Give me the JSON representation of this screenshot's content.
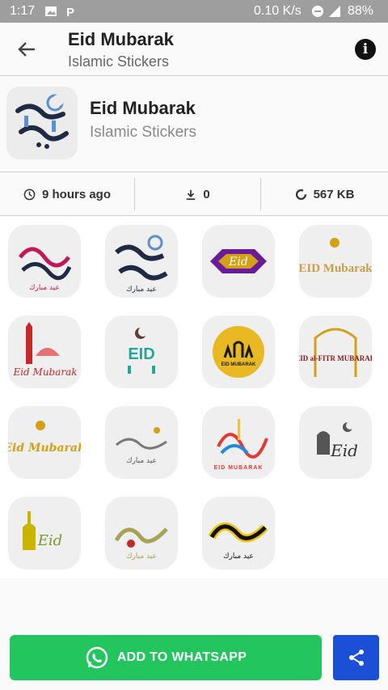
{
  "status_bar": {
    "time": "1:17",
    "net_speed": "0.10 K/s",
    "battery": "88%"
  },
  "app_bar": {
    "title": "Eid Mubarak",
    "subtitle": "Islamic Stickers"
  },
  "pack": {
    "title": "Eid Mubarak",
    "publisher": "Islamic Stickers"
  },
  "stats": {
    "updated": "9 hours ago",
    "downloads": "0",
    "size": "567 KB"
  },
  "stickers": [
    {
      "text": "عيد مبارك",
      "color": "#c2185b"
    },
    {
      "text": "عيد مبارك",
      "color": "#1f2a44"
    },
    {
      "text": "Eid",
      "color": "#6a1b9a"
    },
    {
      "text": "EID Mubarak",
      "color": "#c8a04a"
    },
    {
      "text": "Eid Mubarak",
      "color": "#c62828"
    },
    {
      "text": "EID",
      "color": "#26a69a"
    },
    {
      "text": "EID MUBARAK",
      "color": "#d4a017"
    },
    {
      "text": "EID al-FITR MUBARAK",
      "color": "#8b1a1a"
    },
    {
      "text": "Eid Mubarak",
      "color": "#d4a017"
    },
    {
      "text": "عيد مبارك",
      "color": "#555555"
    },
    {
      "text": "EID MUBARAK",
      "color": "#e53935"
    },
    {
      "text": "Eid",
      "color": "#333333"
    },
    {
      "text": "Eid",
      "color": "#c9b400"
    },
    {
      "text": "عيد مبارك",
      "color": "#a6a356"
    },
    {
      "text": "عيد مبارك",
      "color": "#111111"
    }
  ],
  "footer": {
    "add_label": "ADD TO WHATSAPP"
  },
  "colors": {
    "whatsapp_green": "#23c55e",
    "share_blue": "#1a4fd6"
  }
}
